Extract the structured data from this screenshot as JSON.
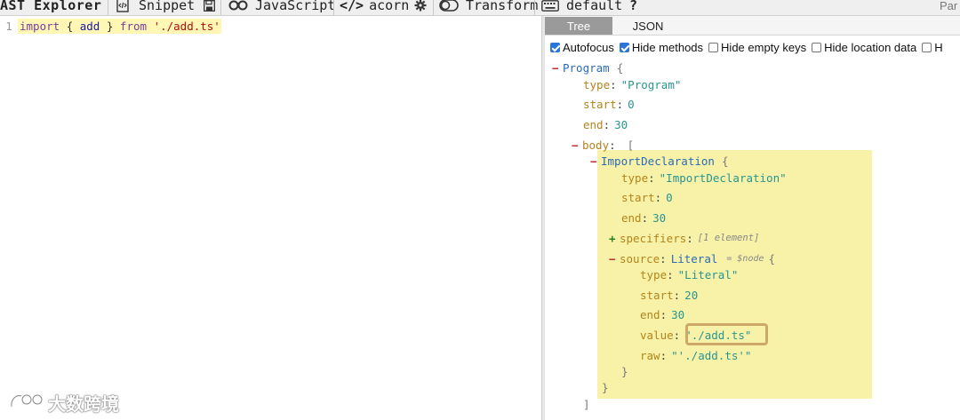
{
  "toolbar": {
    "title": "AST Explorer",
    "snippet_label": "Snippet",
    "language_label": "JavaScript",
    "parser_label": "acorn",
    "transform_label": "Transform",
    "keymap_label": "default",
    "help_label": "?",
    "parser_right_label": "Par"
  },
  "editor": {
    "line_number": "1",
    "code": {
      "import_kw": "import",
      "open_brace": "{",
      "identifier": "add",
      "close_brace": "}",
      "from_kw": "from",
      "source_string": "'./add.ts'"
    }
  },
  "tabs": {
    "tree": "Tree",
    "json": "JSON"
  },
  "options": [
    {
      "label": "Autofocus",
      "checked": true
    },
    {
      "label": "Hide methods",
      "checked": true
    },
    {
      "label": "Hide empty keys",
      "checked": false
    },
    {
      "label": "Hide location data",
      "checked": false
    },
    {
      "label": "H",
      "checked": false
    }
  ],
  "tree": {
    "program": {
      "name": "Program",
      "brace": "{"
    },
    "program_type": {
      "key": "type",
      "value": "\"Program\""
    },
    "program_start": {
      "key": "start",
      "value": "0"
    },
    "program_end": {
      "key": "end",
      "value": "30"
    },
    "body": {
      "key": "body",
      "bracket": "["
    },
    "import_decl": {
      "name": "ImportDeclaration",
      "brace": "{"
    },
    "import_type": {
      "key": "type",
      "value": "\"ImportDeclaration\""
    },
    "import_start": {
      "key": "start",
      "value": "0"
    },
    "import_end": {
      "key": "end",
      "value": "30"
    },
    "specifiers": {
      "key": "specifiers",
      "summary": "[1 element]"
    },
    "source": {
      "key": "source",
      "node_type": "Literal",
      "note": "= $node",
      "brace": "{"
    },
    "literal_type": {
      "key": "type",
      "value": "\"Literal\""
    },
    "literal_start": {
      "key": "start",
      "value": "20"
    },
    "literal_end": {
      "key": "end",
      "value": "30"
    },
    "literal_value": {
      "key": "value",
      "value": "\"./add.ts\""
    },
    "literal_raw": {
      "key": "raw",
      "value": "\"'./add.ts'\""
    },
    "close_source": "}",
    "close_import": "}",
    "close_body": "]"
  },
  "watermark": {
    "text": "大数跨境"
  },
  "colors": {
    "highlight": "#f7f2a8",
    "value_box_border": "#cda869",
    "tab_active_bg": "#9a9a9a",
    "checkbox_on": "#2b74d8"
  }
}
